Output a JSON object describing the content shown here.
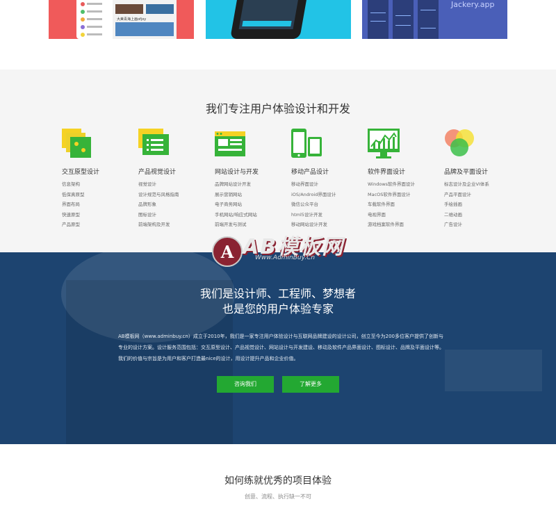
{
  "portfolio": {
    "thumb1_caption": "大美青海上画ofjoy",
    "thumb3_caption": "Jackery.app"
  },
  "services": {
    "title": "我们专注用户体验设计和开发",
    "items": [
      {
        "name": "交互原型设计",
        "icon": "sticky-notes-icon",
        "links": [
          "信息架构",
          "低保真原型",
          "界面布局",
          "快速原型",
          "产品原型"
        ]
      },
      {
        "name": "产品视觉设计",
        "icon": "layered-document-icon",
        "links": [
          "视觉设计",
          "设计规范与风格指南",
          "品牌形象",
          "图标设计",
          "前端架构及开发"
        ]
      },
      {
        "name": "网站设计与开发",
        "icon": "browser-window-icon",
        "links": [
          "品牌网站设计开发",
          "展示营销网站",
          "电子商务网站",
          "手机网站/响应式网站",
          "前端开发与测试"
        ]
      },
      {
        "name": "移动产品设计",
        "icon": "mobile-devices-icon",
        "links": [
          "移动界面设计",
          "iOS/Android界面设计",
          "微信公众平台",
          "html5设计开发",
          "移动网站设计开发"
        ]
      },
      {
        "name": "软件界面设计",
        "icon": "monitor-chart-icon",
        "links": [
          "Windows软件界面设计",
          "MacOS软件界面设计",
          "车载软件界面",
          "电视界面",
          "游戏档案软件界面"
        ]
      },
      {
        "name": "品牌及平面设计",
        "icon": "color-circles-icon",
        "links": [
          "标志设计及企业VI体系",
          "产品平面设计",
          "手绘插画",
          "二维动画",
          "广告设计"
        ]
      }
    ]
  },
  "about": {
    "heading1": "我们是设计师、工程师、梦想者",
    "heading2": "也是您的用户体验专家",
    "description": "AB模板网（www.adminbuy.cn）成立于2010年，我们是一家专注用户体验设计与互联网品牌建设的设计公司，创立至今为200多位客户提供了创新与专业的设计方案。设计服务范围包括：交互原型设计、产品视觉设计、网站设计与开发建设、移动及软件产品界面设计、图标设计、品牌及平面设计等。我们的价值与宗旨是为用户和客户打造最nice的设计，用设计提升产品和企业价值。",
    "contact_button": "咨询我们",
    "more_button": "了解更多"
  },
  "watermark": {
    "logo": "AB模板网",
    "url": "Www.AdminBuy.Cn"
  },
  "experience": {
    "title": "如何练就优秀的项目体验",
    "subtitle": "创意、流程、执行缺一不可"
  }
}
